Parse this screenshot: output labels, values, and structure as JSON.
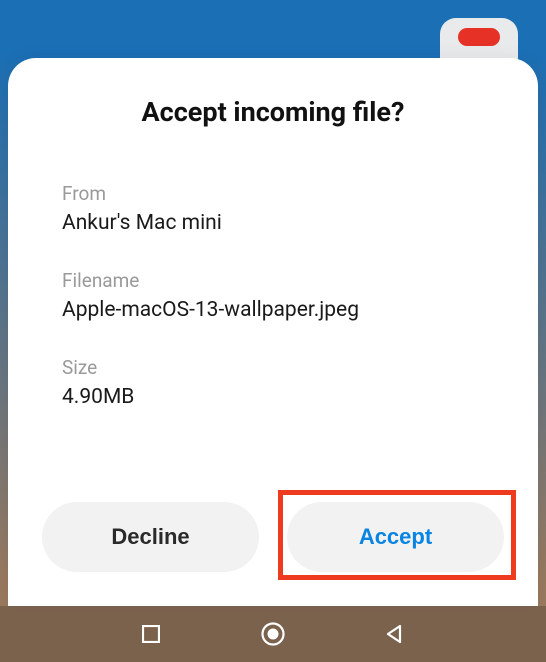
{
  "dialog": {
    "title": "Accept incoming file?",
    "from_label": "From",
    "from_value": "Ankur's Mac mini",
    "filename_label": "Filename",
    "filename_value": "Apple-macOS-13-wallpaper.jpeg",
    "size_label": "Size",
    "size_value": "4.90MB",
    "decline_label": "Decline",
    "accept_label": "Accept"
  }
}
